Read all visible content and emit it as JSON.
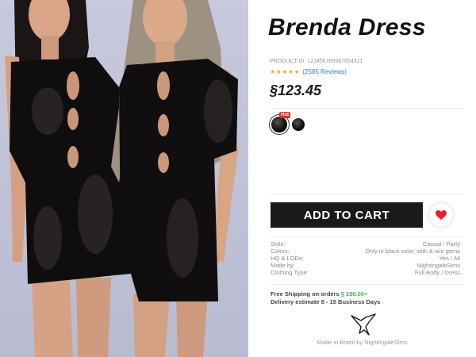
{
  "product": {
    "title": "Brenda Dress",
    "product_id": "PRODUCT ID: 123456789987654321",
    "reviews": "(2585 Reviews)",
    "rating_stars": "★★★★★",
    "price": "§123.45",
    "hot_badge": "Hot",
    "add_to_cart": "ADD TO CART"
  },
  "specs": [
    {
      "label": "Style:",
      "value": "Casual / Party"
    },
    {
      "label": "Colors:",
      "value": "Only in black color, with & w/o gems"
    },
    {
      "label": "HQ & LODs:",
      "value": "Yes / All"
    },
    {
      "label": "Made by:",
      "value": "NightingaleSims"
    },
    {
      "label": "Clothing Type:",
      "value": "Full Body  / Dress"
    }
  ],
  "shipping": {
    "free_prefix": "Free Shipping on orders ",
    "free_amount": "§ 150.00+",
    "delivery_prefix": "Delivery estimate ",
    "delivery_days": "8 - 15 Business Days"
  },
  "footer": {
    "made_in": "Made in Brazil by NightingaleSims"
  },
  "colors": {
    "accent_red": "#e8222c",
    "star": "#f4a623",
    "link": "#2a7fc1",
    "cart": "#1a1a1a",
    "green": "#3fae4b"
  },
  "icons": {
    "favorite": "heart-icon",
    "brand": "nightingale-bird-logo"
  }
}
